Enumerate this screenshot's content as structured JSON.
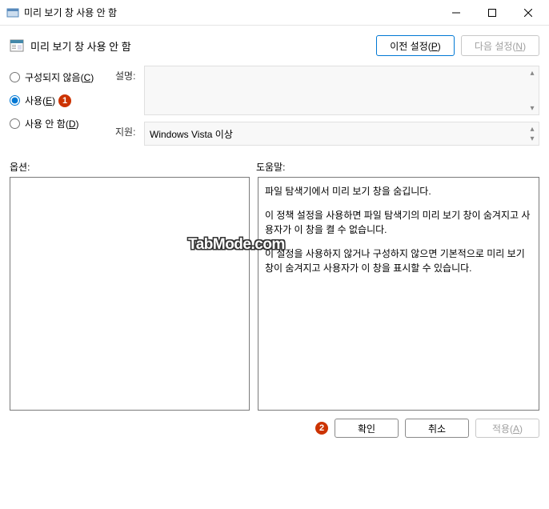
{
  "window": {
    "title": "미리 보기 창 사용 안 함"
  },
  "header": {
    "title": "미리 보기 창 사용 안 함",
    "prev_setting": "이전 설정(P)",
    "next_setting": "다음 설정(N)"
  },
  "radio": {
    "not_configured": "구성되지 않음",
    "not_configured_key": "C",
    "enabled": "사용",
    "enabled_key": "E",
    "disabled": "사용 안 함",
    "disabled_key": "D",
    "selected": "enabled"
  },
  "badges": {
    "enabled_badge": "1",
    "ok_badge": "2"
  },
  "desc": {
    "label": "설명:",
    "text": ""
  },
  "support": {
    "label": "지원:",
    "text": "Windows Vista 이상"
  },
  "panels": {
    "options_label": "옵션:",
    "help_label": "도움말:"
  },
  "help_text": {
    "p1": "파일 탐색기에서 미리 보기 창을 숨깁니다.",
    "p2": "이 정책 설정을 사용하면 파일 탐색기의 미리 보기 창이 숨겨지고 사용자가 이 창을 켤 수 없습니다.",
    "p3": "이 설정을 사용하지 않거나 구성하지 않으면 기본적으로 미리 보기 창이 숨겨지고 사용자가 이 창을 표시할 수 있습니다."
  },
  "buttons": {
    "ok": "확인",
    "cancel": "취소",
    "apply": "적용(A)"
  },
  "watermark": "TabMode.com"
}
